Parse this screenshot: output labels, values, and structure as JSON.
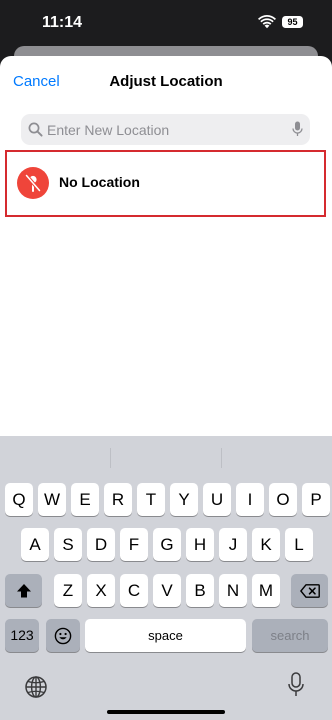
{
  "status_bar": {
    "time": "11:14",
    "battery_level": "95"
  },
  "nav": {
    "cancel_label": "Cancel",
    "title": "Adjust Location"
  },
  "search": {
    "placeholder": "Enter New Location"
  },
  "results": {
    "no_location_label": "No Location",
    "highlight_color": "#d52a2f",
    "icon_color": "#ef453a"
  },
  "keyboard": {
    "row1": [
      "Q",
      "W",
      "E",
      "R",
      "T",
      "Y",
      "U",
      "I",
      "O",
      "P"
    ],
    "row2": [
      "A",
      "S",
      "D",
      "F",
      "G",
      "H",
      "J",
      "K",
      "L"
    ],
    "row3": [
      "Z",
      "X",
      "C",
      "V",
      "B",
      "N",
      "M"
    ],
    "numbers_label": "123",
    "space_label": "space",
    "search_label": "search",
    "icons": [
      "shift-icon",
      "backspace-icon",
      "emoji-icon",
      "globe-icon",
      "dictation-icon"
    ]
  },
  "colors": {
    "accent": "#007aff",
    "keyboard_bg": "#d1d3d9"
  }
}
